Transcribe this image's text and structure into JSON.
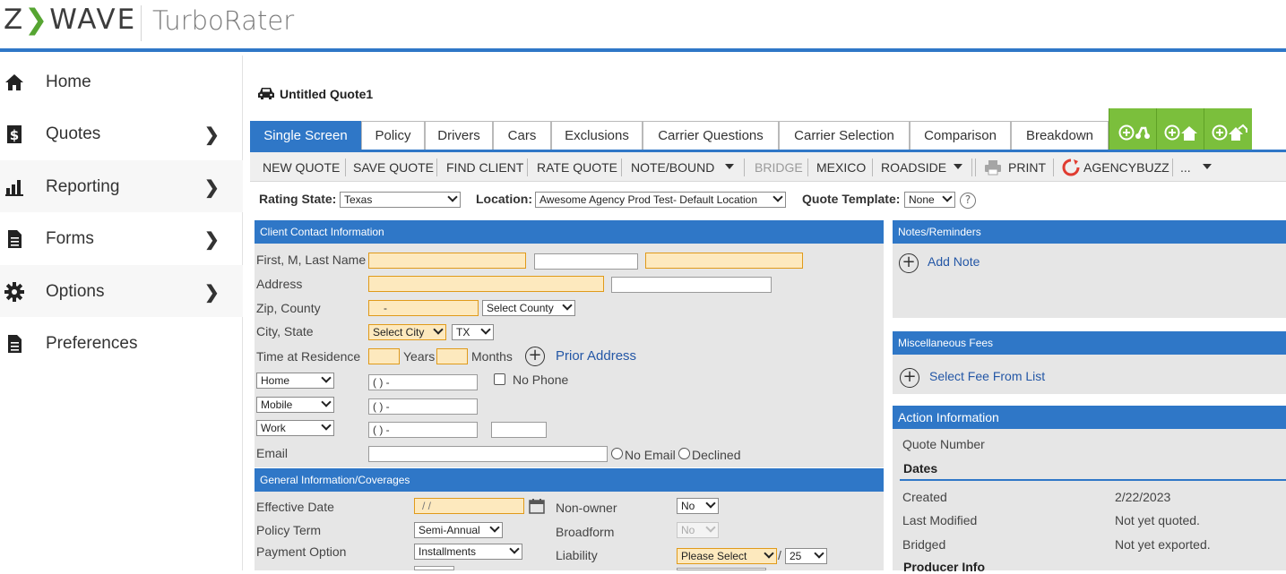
{
  "app": {
    "logo_text_a": "Z",
    "logo_text_chev": "❯",
    "logo_text_b": "WAVE",
    "product_name": "TurboRater"
  },
  "sidebar": {
    "items": [
      {
        "label": "Home",
        "icon": "home-icon",
        "has_chevron": false
      },
      {
        "label": "Quotes",
        "icon": "dollar-doc-icon",
        "has_chevron": true
      },
      {
        "label": "Reporting",
        "icon": "bar-chart-icon",
        "has_chevron": true
      },
      {
        "label": "Forms",
        "icon": "document-icon",
        "has_chevron": true
      },
      {
        "label": "Options",
        "icon": "gear-icon",
        "has_chevron": true
      },
      {
        "label": "Preferences",
        "icon": "document-icon",
        "has_chevron": false
      }
    ],
    "chevron": "❯"
  },
  "quote": {
    "title": "Untitled Quote1",
    "icon": "car-icon"
  },
  "tabs": [
    {
      "label": "Single Screen",
      "active": true
    },
    {
      "label": "Policy",
      "active": false
    },
    {
      "label": "Drivers",
      "active": false
    },
    {
      "label": "Cars",
      "active": false
    },
    {
      "label": "Exclusions",
      "active": false
    },
    {
      "label": "Carrier Questions",
      "active": false
    },
    {
      "label": "Carrier Selection",
      "active": false
    },
    {
      "label": "Comparison",
      "active": false
    },
    {
      "label": "Breakdown",
      "active": false
    }
  ],
  "green_tabs": [
    {
      "icon": "add-motorcycle-icon"
    },
    {
      "icon": "add-home-icon"
    },
    {
      "icon": "add-dwelling-icon"
    }
  ],
  "toolbar": {
    "new_quote": "NEW QUOTE",
    "save_quote": "SAVE QUOTE",
    "find_client": "FIND CLIENT",
    "rate_quote": "RATE QUOTE",
    "note_bound": "NOTE/BOUND",
    "bridge": "BRIDGE",
    "mexico": "MEXICO",
    "roadside": "ROADSIDE",
    "print": "PRINT",
    "agencybuzz": "AGENCYBUZZ",
    "more": "..."
  },
  "rating": {
    "state_label": "Rating State:",
    "state_value": "Texas",
    "location_label": "Location:",
    "location_value": "Awesome Agency Prod Test- Default Location",
    "template_label": "Quote Template:",
    "template_value": "None",
    "help": "?"
  },
  "client_contact": {
    "header": "Client Contact Information",
    "name_label": "First, M, Last Name",
    "address_label": "Address",
    "zip_label": "Zip, County",
    "zip_value": "-",
    "county_select": "Select County",
    "city_label": "City, State",
    "city_select": "Select City",
    "state_select": "TX",
    "residence_label": "Time at Residence",
    "years_label": "Years",
    "months_label": "Months",
    "prior_address_link": "Prior Address",
    "phones": [
      {
        "type": "Home",
        "value": "( )  -"
      },
      {
        "type": "Mobile",
        "value": "( )  -"
      },
      {
        "type": "Work",
        "value": "( )  -"
      }
    ],
    "no_phone_label": "No Phone",
    "email_label": "Email",
    "no_email_label": "No Email",
    "declined_label": "Declined"
  },
  "general_info": {
    "header": "General Information/Coverages",
    "effective_date_label": "Effective Date",
    "effective_date_value": "/ /",
    "policy_term_label": "Policy Term",
    "policy_term_value": "Semi-Annual",
    "payment_option_label": "Payment Option",
    "payment_option_value": "Installments",
    "non_owner_label": "Non-owner",
    "non_owner_value": "No",
    "broadform_label": "Broadform",
    "broadform_value": "No",
    "liability_label": "Liability",
    "liability_value": "Please Select",
    "liability_slash": "/",
    "liability_limit": "25"
  },
  "notes": {
    "header": "Notes/Reminders",
    "add_note_link": "Add Note"
  },
  "misc_fees": {
    "header": "Miscellaneous Fees",
    "select_fee_link": "Select Fee From List"
  },
  "action_info": {
    "header": "Action Information",
    "quote_number_label": "Quote Number",
    "dates_heading": "Dates",
    "created_label": "Created",
    "created_value": "2/22/2023",
    "last_modified_label": "Last Modified",
    "last_modified_value": "Not yet quoted.",
    "bridged_label": "Bridged",
    "bridged_value": "Not yet exported.",
    "producer_info_heading": "Producer Info"
  },
  "colors": {
    "brand_blue": "#2f77c7",
    "brand_green": "#7bbf3c",
    "required_field": "#fde9be",
    "required_border": "#e09a1a",
    "link": "#2457a6"
  }
}
